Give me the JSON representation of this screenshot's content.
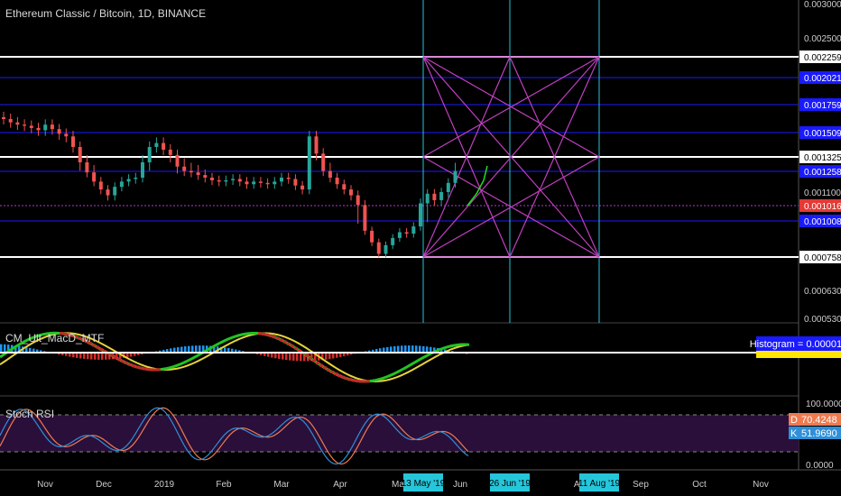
{
  "title": "Ethereum Classic / Bitcoin, 1D, BINANCE",
  "colors": {
    "background": "#000000",
    "up": "#26a69a",
    "down": "#ef5350",
    "blue_line": "#1a1aff",
    "white_line": "#ffffff",
    "purple": "#c040c0",
    "cyan": "#26c6da",
    "stoch_band": "#2a0f3a"
  },
  "chart_data": [
    {
      "type": "line",
      "panel": "price",
      "series": [
        {
          "values": [
            0.00163,
            0.0016,
            0.00158,
            0.00157,
            0.00155,
            0.00153,
            0.00158,
            0.00154,
            0.0015,
            0.00148,
            0.0014,
            0.0013,
            0.00125,
            0.00118,
            0.00112,
            0.00108,
            0.00114,
            0.00118,
            0.0012,
            0.00121,
            0.0013,
            0.0014,
            0.00143,
            0.00138,
            0.00134,
            0.00128,
            0.00126,
            0.00125,
            0.00123,
            0.00121,
            0.00119,
            0.00118,
            0.00119,
            0.0012,
            0.00118,
            0.00116,
            0.00118,
            0.00117,
            0.00116,
            0.00118,
            0.00121,
            0.0012,
            0.00115,
            0.00112,
            0.00148,
            0.00135,
            0.00126,
            0.00121,
            0.00116,
            0.00112,
            0.00108,
            0.00102,
            0.00094,
            0.00086,
            0.00078,
            0.00084,
            0.00089,
            0.00093,
            0.00092,
            0.00097,
            0.00103,
            0.00109,
            0.00105,
            0.0011,
            0.00117,
            0.00126
          ]
        }
      ],
      "x_axis_labels": [
        "Nov",
        "Dec",
        "2019",
        "Feb",
        "Mar",
        "Apr",
        "Ma",
        "Jun",
        "Au",
        "Sep",
        "Oct",
        "Nov"
      ],
      "y_axis_labels": [
        "0.003000",
        "0.002500",
        "0.002259",
        "0.002021",
        "0.001759",
        "0.001509",
        "0.001325",
        "0.001258",
        "0.001100",
        "0.001016",
        "0.001008",
        "0.000758",
        "0.000630",
        "0.000530"
      ],
      "highlighted_levels": [
        {
          "value": "0.002259",
          "style": "white"
        },
        {
          "value": "0.002021",
          "style": "blue"
        },
        {
          "value": "0.001759",
          "style": "blue"
        },
        {
          "value": "0.001509",
          "style": "blue"
        },
        {
          "value": "0.001325",
          "style": "white"
        },
        {
          "value": "0.001258",
          "style": "blue"
        },
        {
          "value": "0.001016",
          "style": "red"
        },
        {
          "value": "0.001008",
          "style": "blue"
        },
        {
          "value": "0.000758",
          "style": "white"
        }
      ],
      "date_markers": [
        "13 May '19",
        "26 Jun '19",
        "11 Aug '19"
      ]
    },
    {
      "type": "line",
      "panel": "macd",
      "title": "CM_Ult_MacD_MTF",
      "badge": "Histogram = 0.000018"
    },
    {
      "type": "line",
      "panel": "stoch",
      "title": "Stoch RSI",
      "y_axis_labels": [
        "100.0000",
        "0.0000"
      ],
      "badges": [
        {
          "letter": "D",
          "value": "70.4248"
        },
        {
          "letter": "K",
          "value": "51.9690"
        }
      ]
    }
  ]
}
